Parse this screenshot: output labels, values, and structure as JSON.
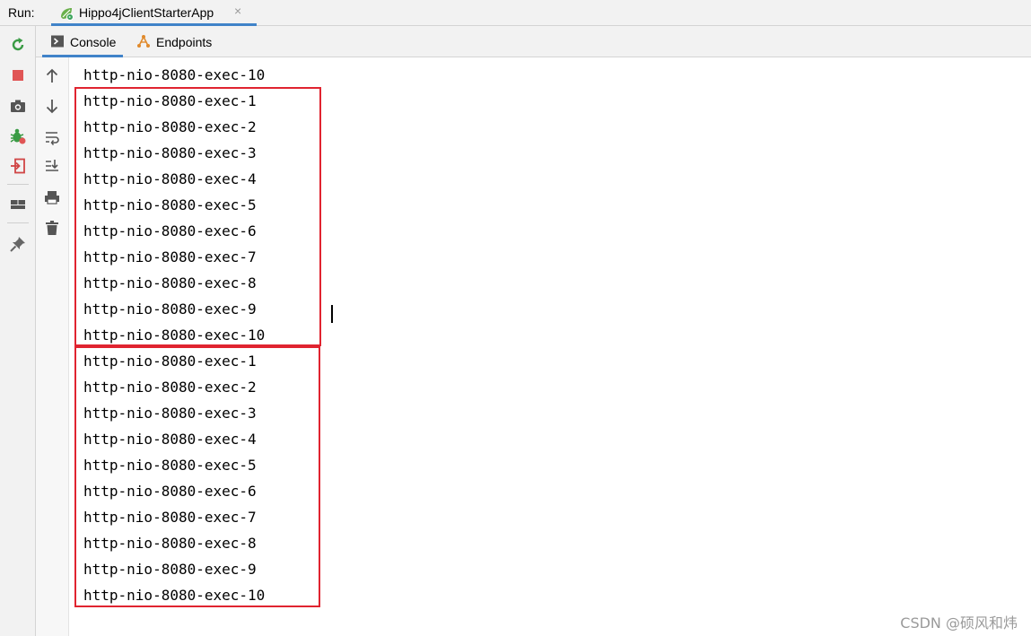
{
  "run_bar": {
    "label": "Run:",
    "tab_title": "Hippo4jClientStarterApp",
    "close_glyph": "×"
  },
  "left_toolbar": {
    "icons": [
      "rerun-icon",
      "stop-icon",
      "camera-icon",
      "debug-bug-icon",
      "restore-layout-icon",
      "layout-icon",
      "pin-icon"
    ]
  },
  "sub_tabs": [
    {
      "label": "Console",
      "icon": "console-icon",
      "active": true
    },
    {
      "label": "Endpoints",
      "icon": "endpoints-icon",
      "active": false
    }
  ],
  "gutter": {
    "icons": [
      "up-arrow-icon",
      "down-arrow-icon",
      "soft-wrap-icon",
      "scroll-to-end-icon",
      "print-icon",
      "trash-icon"
    ]
  },
  "console": {
    "lines": [
      "http-nio-8080-exec-10",
      "http-nio-8080-exec-1",
      "http-nio-8080-exec-2",
      "http-nio-8080-exec-3",
      "http-nio-8080-exec-4",
      "http-nio-8080-exec-5",
      "http-nio-8080-exec-6",
      "http-nio-8080-exec-7",
      "http-nio-8080-exec-8",
      "http-nio-8080-exec-9",
      "http-nio-8080-exec-10",
      "http-nio-8080-exec-1",
      "http-nio-8080-exec-2",
      "http-nio-8080-exec-3",
      "http-nio-8080-exec-4",
      "http-nio-8080-exec-5",
      "http-nio-8080-exec-6",
      "http-nio-8080-exec-7",
      "http-nio-8080-exec-8",
      "http-nio-8080-exec-9",
      "http-nio-8080-exec-10"
    ]
  },
  "watermark": "CSDN @硕风和炜",
  "colors": {
    "accent_tab_underline": "#4083c9",
    "highlight_box": "#e02430",
    "toolbar_bg": "#f2f2f2"
  }
}
